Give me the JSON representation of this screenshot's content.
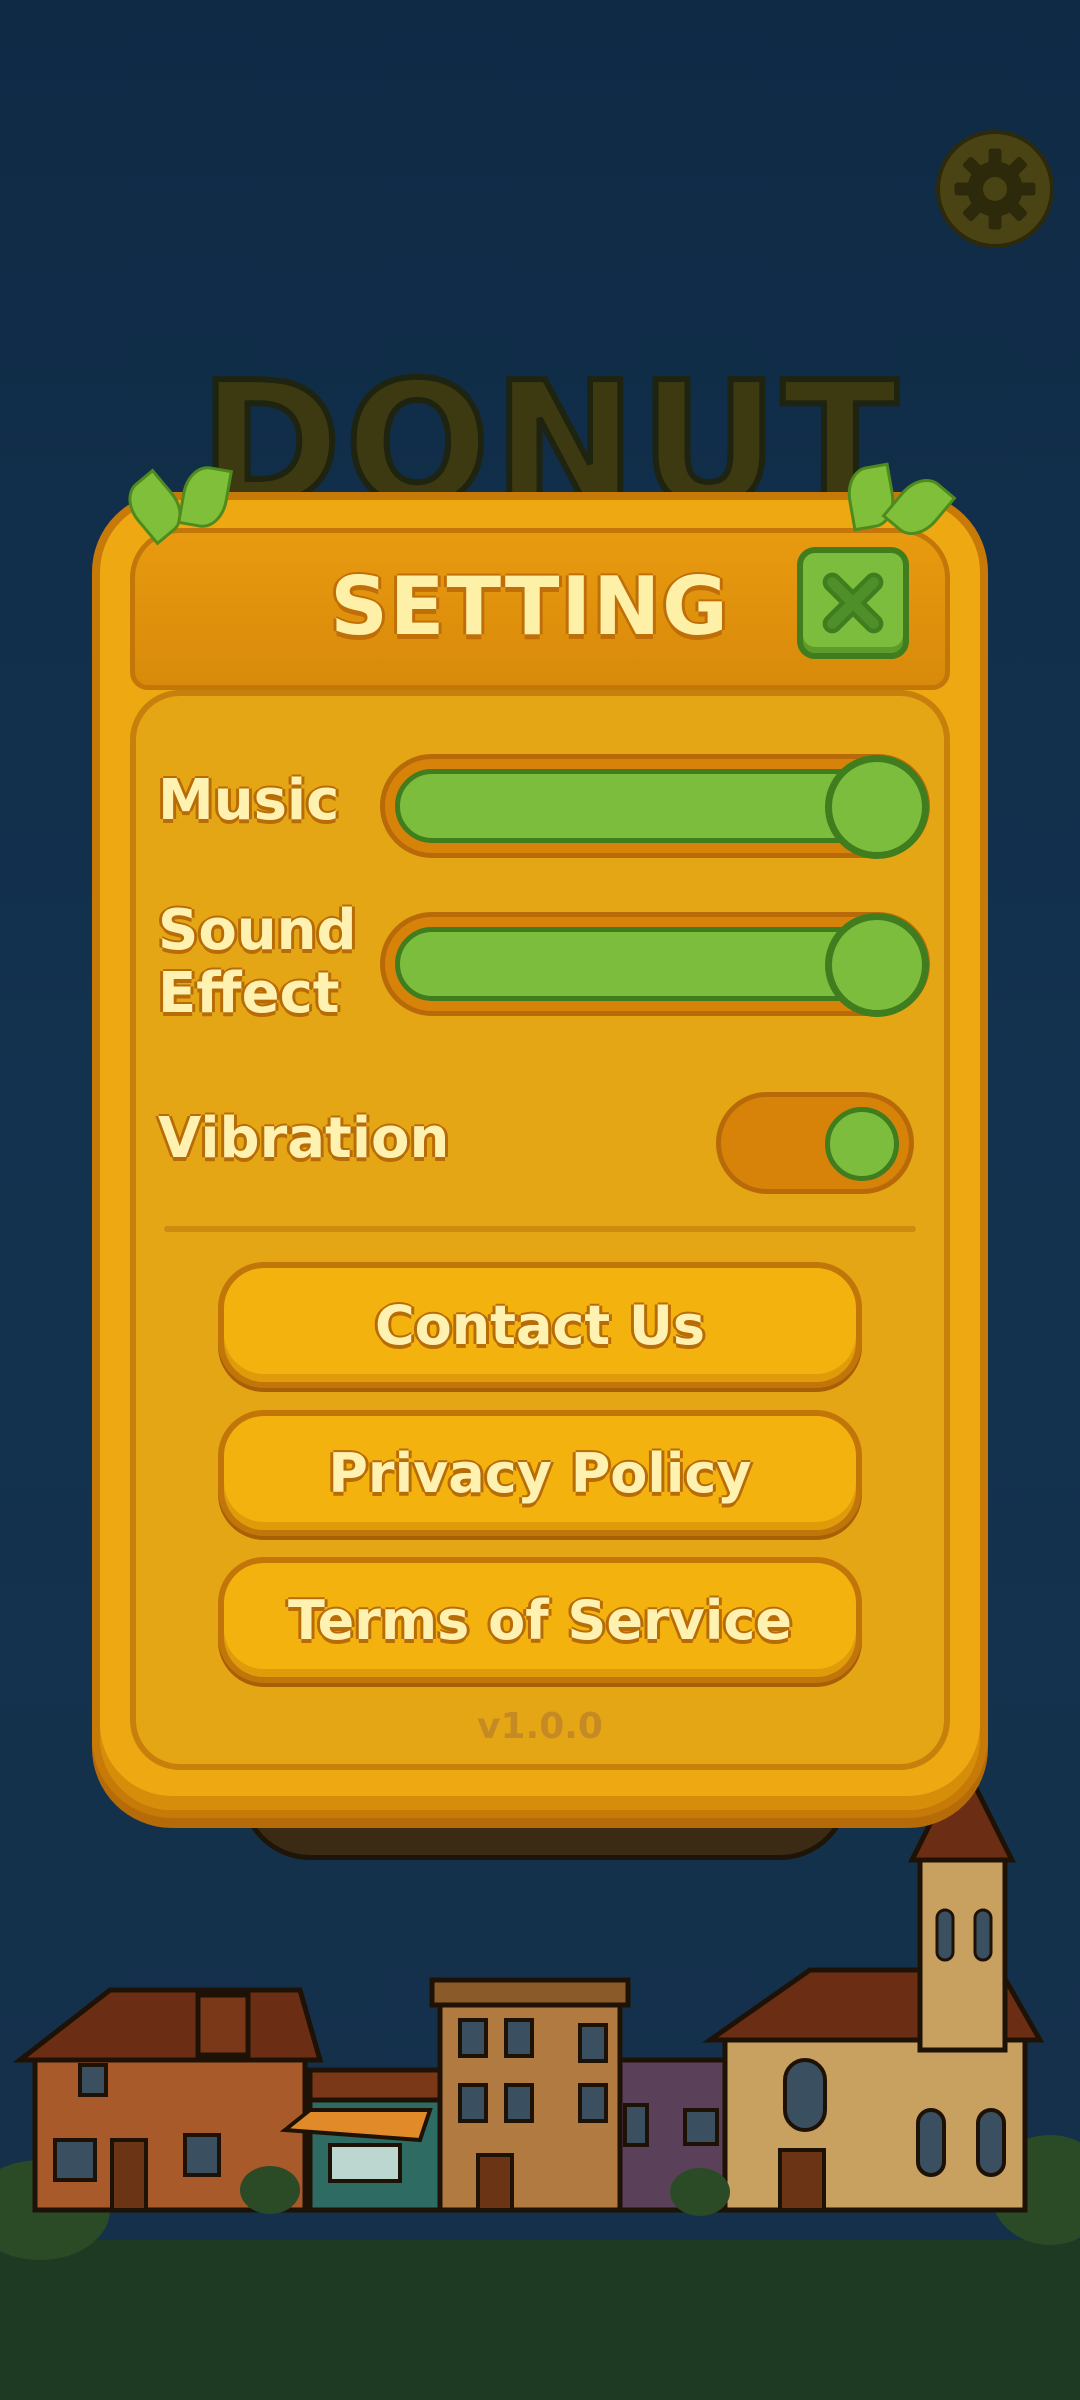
{
  "background": {
    "game_title": "DONUT"
  },
  "dialog": {
    "title": "SETTING",
    "close_icon": "close-x-icon",
    "rows": {
      "music": {
        "label": "Music",
        "level": 1.0
      },
      "sound_effect": {
        "label_line1": "Sound",
        "label_line2": "Effect",
        "level": 1.0
      },
      "vibration": {
        "label": "Vibration",
        "on": true
      }
    },
    "buttons": {
      "contact": "Contact Us",
      "privacy": "Privacy Policy",
      "terms": "Terms of Service"
    },
    "version": "v1.0.0"
  },
  "icons": {
    "top_right": "gear-icon"
  },
  "colors": {
    "background": "#13324f",
    "panel": "#eea812",
    "accent_green": "#7cbd3d",
    "text": "#fff2b0"
  }
}
